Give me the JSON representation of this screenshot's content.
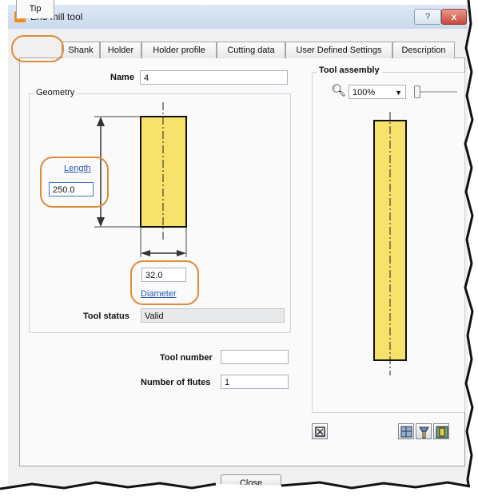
{
  "window": {
    "title": "End mill tool",
    "app_icon_glyph": "P",
    "help_button_label": "?",
    "close_glyph": "x"
  },
  "tabs": [
    {
      "label": "Tip"
    },
    {
      "label": "Shank"
    },
    {
      "label": "Holder"
    },
    {
      "label": "Holder profile"
    },
    {
      "label": "Cutting data"
    },
    {
      "label": "User Defined Settings"
    },
    {
      "label": "Description"
    }
  ],
  "active_tab": "Tip",
  "form": {
    "name_label": "Name",
    "name_value": "4",
    "geometry_title": "Geometry",
    "length_link": "Length",
    "length_value": "250.0",
    "diameter_value": "32.0",
    "diameter_link": "Diameter",
    "tool_status_label": "Tool status",
    "tool_status_value": "Valid",
    "tool_number_label": "Tool number",
    "tool_number_value": "",
    "flutes_label": "Number of flutes",
    "flutes_value": "1"
  },
  "assembly": {
    "title": "Tool assembly",
    "zoom_value": "100%"
  },
  "footer": {
    "close_label": "Close"
  },
  "colors": {
    "tool_fill": "#f7e36b",
    "highlight_ring": "#e08b3b",
    "link": "#2a57b3"
  },
  "icons": [
    "magnifier-icon",
    "dropdown-arrow-icon",
    "zoom-slider-icon",
    "fit-view-icon",
    "assembly-view-icon",
    "holder-view-icon",
    "shank-view-icon"
  ]
}
